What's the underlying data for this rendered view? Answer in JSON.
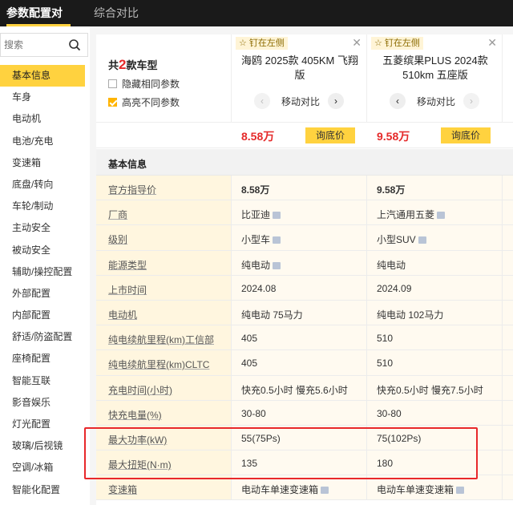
{
  "tabs": [
    "参数配置对比",
    "综合对比"
  ],
  "search": {
    "placeholder": "搜索"
  },
  "sidebar": [
    "基本信息",
    "车身",
    "电动机",
    "电池/充电",
    "变速箱",
    "底盘/转向",
    "车轮/制动",
    "主动安全",
    "被动安全",
    "辅助/操控配置",
    "外部配置",
    "内部配置",
    "舒适/防盗配置",
    "座椅配置",
    "智能互联",
    "影音娱乐",
    "灯光配置",
    "玻璃/后视镜",
    "空调/冰箱",
    "智能化配置"
  ],
  "header": {
    "count_prefix": "共",
    "count_num": "2",
    "count_suffix": "款车型",
    "hide_same": "隐藏相同参数",
    "highlight_diff": "高亮不同参数"
  },
  "cars": [
    {
      "pin": "☆ 钉在左侧",
      "name": "海鸥 2025款 405KM 飞翔版",
      "move": "移动对比",
      "price": "8.58万",
      "ask": "询底价"
    },
    {
      "pin": "☆ 钉在左侧",
      "name": "五菱缤果PLUS 2024款 510km 五座版",
      "move": "移动对比",
      "price": "9.58万",
      "ask": "询底价"
    }
  ],
  "section_title": "基本信息",
  "rows": [
    {
      "label": "官方指导价",
      "v1": "8.58万",
      "v2": "9.58万",
      "bold": true
    },
    {
      "label": "厂商",
      "v1": "比亚迪",
      "v2": "上汽通用五菱",
      "tag": true
    },
    {
      "label": "级别",
      "v1": "小型车",
      "v2": "小型SUV",
      "tag": true
    },
    {
      "label": "能源类型",
      "v1": "纯电动",
      "v2": "纯电动",
      "tag1only": true
    },
    {
      "label": "上市时间",
      "v1": "2024.08",
      "v2": "2024.09"
    },
    {
      "label": "电动机",
      "v1": "纯电动 75马力",
      "v2": "纯电动 102马力"
    },
    {
      "label": "纯电续航里程(km)工信部",
      "v1": "405",
      "v2": "510"
    },
    {
      "label": "纯电续航里程(km)CLTC",
      "v1": "405",
      "v2": "510"
    },
    {
      "label": "充电时间(小时)",
      "v1": "快充0.5小时 慢充5.6小时",
      "v2": "快充0.5小时 慢充7.5小时"
    },
    {
      "label": "快充电量(%)",
      "v1": "30-80",
      "v2": "30-80"
    },
    {
      "label": "最大功率(kW)",
      "v1": "55(75Ps)",
      "v2": "75(102Ps)"
    },
    {
      "label": "最大扭矩(N·m)",
      "v1": "135",
      "v2": "180"
    },
    {
      "label": "变速箱",
      "v1": "电动车单速变速箱",
      "v2": "电动车单速变速箱",
      "tag": true
    }
  ]
}
